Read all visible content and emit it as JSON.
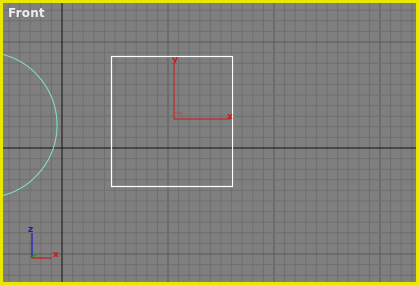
{
  "viewport": {
    "label": "Front",
    "border_color": "#e8e800",
    "background_color": "#7f7f7f",
    "grid_minor_color": "#6f6f6f",
    "grid_major_color": "#5a5a5a",
    "world_axis_color": "#111111"
  },
  "objects": {
    "rectangle": {
      "color": "#ffffff",
      "selected": true
    },
    "circle": {
      "color": "#7fe6c6"
    }
  },
  "transform_gizmo": {
    "x_label": "x",
    "y_label": "y",
    "color": "#cc1a1a"
  },
  "axis_tripod": {
    "z_label": "z",
    "x_label": "x",
    "z_color": "#1a1acc",
    "x_color": "#cc1a1a",
    "y_color": "#1aa01a"
  }
}
